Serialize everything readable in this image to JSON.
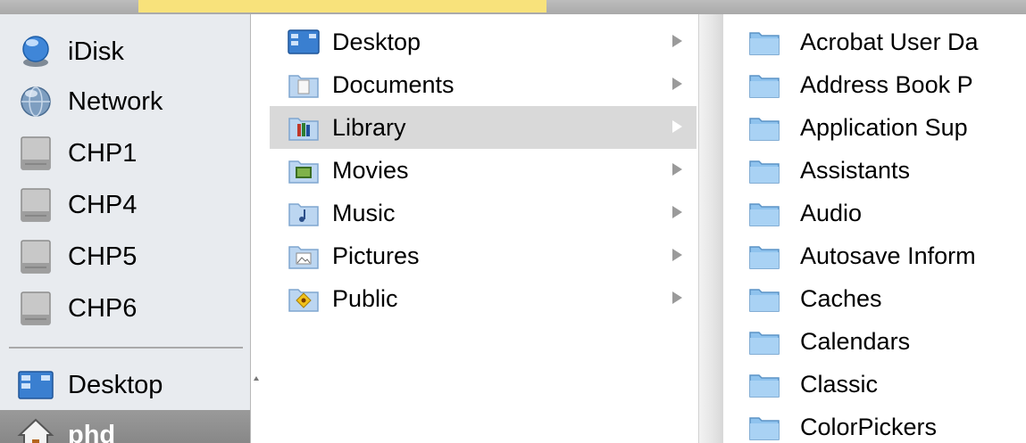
{
  "sidebar": {
    "devices": [
      {
        "label": "iDisk",
        "icon": "idisk-icon"
      },
      {
        "label": "Network",
        "icon": "network-icon"
      },
      {
        "label": "CHP1",
        "icon": "hard-drive-icon"
      },
      {
        "label": "CHP4",
        "icon": "hard-drive-icon"
      },
      {
        "label": "CHP5",
        "icon": "hard-drive-icon"
      },
      {
        "label": "CHP6",
        "icon": "hard-drive-icon"
      }
    ],
    "places": [
      {
        "label": "Desktop",
        "icon": "desktop-icon"
      },
      {
        "label": "phd",
        "icon": "home-icon",
        "selected": true
      }
    ]
  },
  "column1": {
    "items": [
      {
        "label": "Desktop",
        "icon": "desktop-folder-icon"
      },
      {
        "label": "Documents",
        "icon": "documents-folder-icon"
      },
      {
        "label": "Library",
        "icon": "library-folder-icon",
        "selected": true
      },
      {
        "label": "Movies",
        "icon": "movies-folder-icon"
      },
      {
        "label": "Music",
        "icon": "music-folder-icon"
      },
      {
        "label": "Pictures",
        "icon": "pictures-folder-icon"
      },
      {
        "label": "Public",
        "icon": "public-folder-icon"
      }
    ]
  },
  "column2": {
    "items": [
      {
        "label": "Acrobat User Da"
      },
      {
        "label": "Address Book P"
      },
      {
        "label": "Application Sup"
      },
      {
        "label": "Assistants"
      },
      {
        "label": "Audio"
      },
      {
        "label": "Autosave Inform"
      },
      {
        "label": "Caches"
      },
      {
        "label": "Calendars"
      },
      {
        "label": "Classic"
      },
      {
        "label": "ColorPickers"
      }
    ]
  },
  "colors": {
    "highlight_tab": "#f8e27b",
    "folder_blue": "#8fc3ee",
    "selection_gray": "#d9d9d9"
  }
}
